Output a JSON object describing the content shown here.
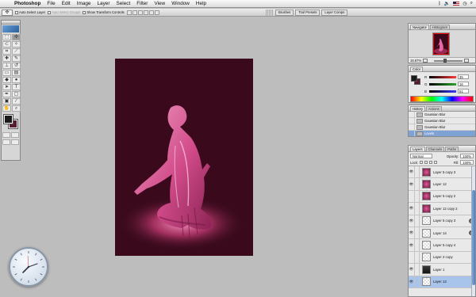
{
  "menubar": {
    "apple": "",
    "app": "Photoshop",
    "menus": [
      "File",
      "Edit",
      "Image",
      "Layer",
      "Select",
      "Filter",
      "View",
      "Window",
      "Help"
    ]
  },
  "options": {
    "auto_select_layer": "Auto Select Layer",
    "auto_select_groups": "Auto Select Groups",
    "show_transform_controls": "Show Transform Controls"
  },
  "palette_well": [
    "Brushes",
    "Tool Presets",
    "Layer Comps"
  ],
  "navigator": {
    "tabs": [
      "Navigator",
      "Histogram"
    ],
    "zoom": "16.67%"
  },
  "color": {
    "tabs": [
      "Color"
    ],
    "channels": [
      {
        "label": "R",
        "value": "35",
        "ramp": "#ff3a3a"
      },
      {
        "label": "G",
        "value": "16",
        "ramp": "#2aa82a"
      },
      {
        "label": "B",
        "value": "51",
        "ramp": "#3a3aff"
      }
    ]
  },
  "history": {
    "tabs": [
      "History",
      "Actions"
    ],
    "items": [
      "Gaussian Blur",
      "Gaussian Blur",
      "Gaussian Blur",
      "Levels"
    ],
    "selected_index": 3
  },
  "layers": {
    "tabs": [
      "Layers",
      "Channels",
      "Paths"
    ],
    "blend_mode": "Normal",
    "opacity_label": "Opacity:",
    "opacity": "100%",
    "lock_label": "Lock:",
    "fill_label": "Fill:",
    "fill": "100%",
    "items": [
      {
        "name": "Layer 5 copy 3",
        "thumb": "pink",
        "eye": true,
        "fx": false
      },
      {
        "name": "Layer 12",
        "thumb": "pink",
        "eye": true,
        "fx": false
      },
      {
        "name": "Layer 5 copy 2",
        "thumb": "pink",
        "eye": false,
        "fx": false
      },
      {
        "name": "Layer 12 copy 2",
        "thumb": "pink",
        "eye": true,
        "fx": false
      },
      {
        "name": "Layer 5 copy 3",
        "thumb": "plain",
        "eye": true,
        "fx": true
      },
      {
        "name": "Layer 14",
        "thumb": "plain",
        "eye": true,
        "fx": true
      },
      {
        "name": "Layer 5 copy 4",
        "thumb": "plain",
        "eye": true,
        "fx": false
      },
      {
        "name": "Layer 2 copy",
        "thumb": "plain",
        "eye": false,
        "fx": false
      },
      {
        "name": "Layer 1",
        "thumb": "dark",
        "eye": true,
        "fx": false
      },
      {
        "name": "Layer 13",
        "thumb": "plain",
        "eye": true,
        "fx": false
      }
    ],
    "selected_index": 9
  },
  "colors": {
    "canvas_bg": "#3a0a1c",
    "figure": "#e0579a",
    "selection": "#a9c4ea"
  }
}
